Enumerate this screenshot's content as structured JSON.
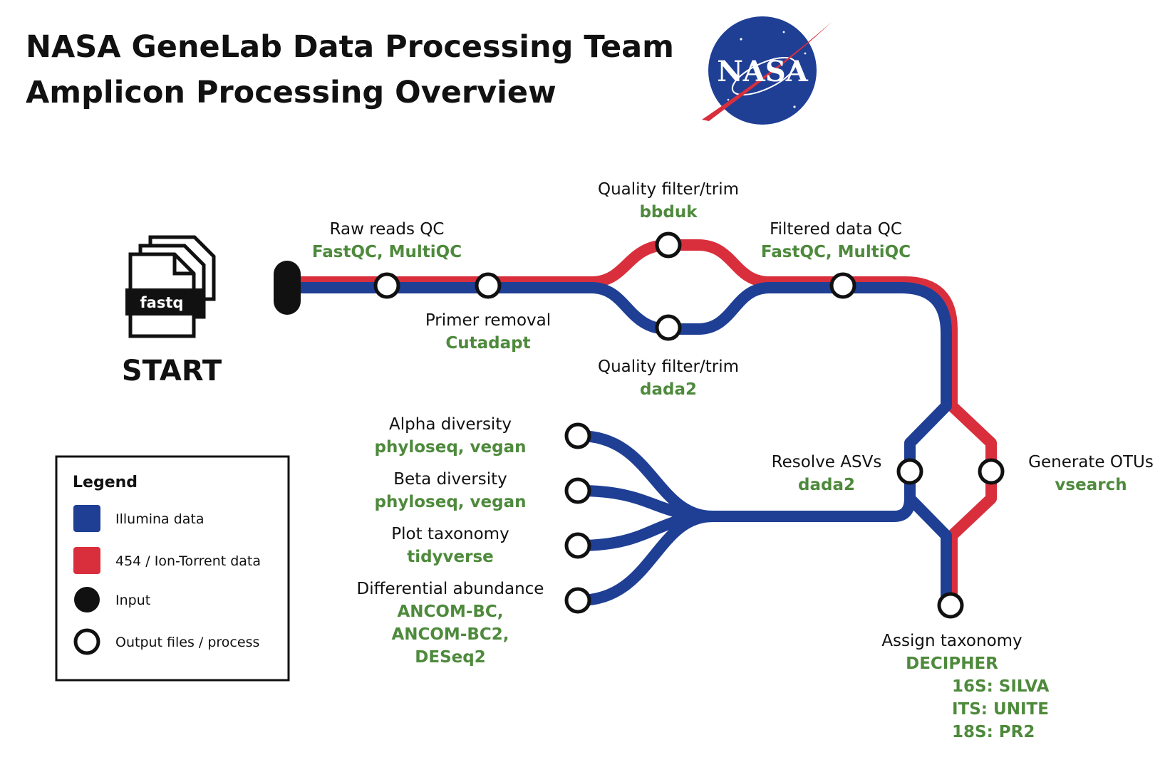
{
  "title": {
    "line1": "NASA GeneLab Data Processing Team",
    "line2": "Amplicon Processing Overview"
  },
  "logo": {
    "text": "NASA",
    "icon": "nasa-meatball-logo"
  },
  "start": {
    "file_label": "fastq",
    "label": "START",
    "icon": "file-stack-icon"
  },
  "colors": {
    "illumina": "#1f3f95",
    "ion_torrent": "#d92f3c",
    "tool_text": "#4e8a3c",
    "node_outline": "#111111"
  },
  "steps": {
    "raw_qc": {
      "label": "Raw reads QC",
      "tool": "FastQC, MultiQC"
    },
    "primer": {
      "label": "Primer removal",
      "tool": "Cutadapt"
    },
    "qf_red": {
      "label": "Quality filter/trim",
      "tool": "bbduk"
    },
    "qf_blue": {
      "label": "Quality filter/trim",
      "tool": "dada2"
    },
    "filtered_qc": {
      "label": "Filtered data QC",
      "tool": "FastQC, MultiQC"
    },
    "asvs": {
      "label": "Resolve ASVs",
      "tool": "dada2"
    },
    "otus": {
      "label": "Generate OTUs",
      "tool": "vsearch"
    },
    "taxonomy": {
      "label": "Assign taxonomy",
      "tool": "DECIPHER",
      "databases": [
        "16S: SILVA",
        "ITS: UNITE",
        "18S: PR2"
      ]
    },
    "alpha": {
      "label": "Alpha diversity",
      "tool": "phyloseq, vegan"
    },
    "beta": {
      "label": "Beta diversity",
      "tool": "phyloseq, vegan"
    },
    "plot_tax": {
      "label": "Plot taxonomy",
      "tool": "tidyverse"
    },
    "diff": {
      "label": "Differential abundance",
      "tools": [
        "ANCOM-BC,",
        "ANCOM-BC2,",
        "DESeq2"
      ]
    }
  },
  "legend": {
    "title": "Legend",
    "items": [
      {
        "label": "Illumina data",
        "symbol": "blue-square"
      },
      {
        "label": "454 / Ion-Torrent data",
        "symbol": "red-square"
      },
      {
        "label": "Input",
        "symbol": "filled-circle"
      },
      {
        "label": "Output files / process",
        "symbol": "open-circle"
      }
    ]
  }
}
